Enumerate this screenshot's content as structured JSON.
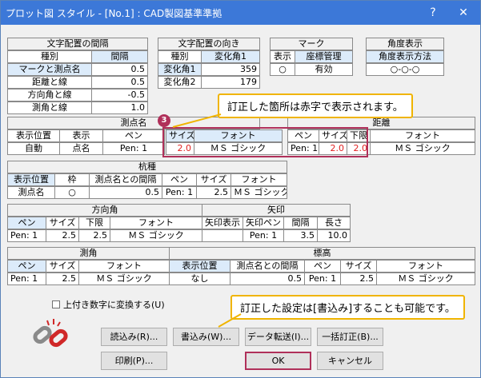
{
  "window": {
    "title": "プロット図 スタイル - [No.1] : CAD製図基準準拠",
    "help": "?",
    "close": "✕"
  },
  "moji_haichi": {
    "title": "文字配置の間隔",
    "col_kind": "種別",
    "col_interval": "間隔",
    "rows": [
      {
        "label": "マークと測点名",
        "value": "0.5"
      },
      {
        "label": "距離と線",
        "value": "0.5"
      },
      {
        "label": "方向角と線",
        "value": "-0.5"
      },
      {
        "label": "測角と線",
        "value": "1.0"
      }
    ]
  },
  "moji_muki": {
    "title": "文字配置の向き",
    "col_kind": "種別",
    "col_angle": "変化角1",
    "rows": [
      {
        "label": "変化角1",
        "value": "359"
      },
      {
        "label": "変化角2",
        "value": "179"
      }
    ]
  },
  "mark": {
    "title": "マーク",
    "col_display": "表示",
    "col_coord": "座標管理",
    "display": "○",
    "coord": "有効"
  },
  "angle_display": {
    "title": "角度表示",
    "col_method": "角度表示方法",
    "method": "○-○-○"
  },
  "sokuten": {
    "title": "測点名",
    "col_pos": "表示位置",
    "col_display": "表示",
    "col_pen": "ペン",
    "col_size": "サイズ",
    "col_font": "フォント",
    "pos": "自動",
    "display": "点名",
    "pen": "Pen: 1",
    "size": "2.0",
    "font": "ＭＳ ゴシック"
  },
  "kyori": {
    "title": "距離",
    "col_pen": "ペン",
    "col_size": "サイズ",
    "col_lower": "下限",
    "col_font": "フォント",
    "pen": "Pen: 1",
    "size": "2.0",
    "lower": "2.0",
    "font": "ＭＳ ゴシック"
  },
  "kuishu": {
    "title": "杭種",
    "col_pos": "表示位置",
    "col_frame": "枠",
    "col_gap": "測点名との間隔",
    "col_pen": "ペン",
    "col_size": "サイズ",
    "col_font": "フォント",
    "pos": "測点名",
    "frame": "○",
    "gap": "0.5",
    "pen": "Pen: 1",
    "size": "2.5",
    "font": "ＭＳ ゴシック"
  },
  "houkou": {
    "title": "方向角",
    "col_pen": "ペン",
    "col_size": "サイズ",
    "col_lower": "下限",
    "col_font": "フォント",
    "pen": "Pen: 1",
    "size": "2.5",
    "lower": "2.5",
    "font": "ＭＳ ゴシック"
  },
  "yajirushi": {
    "title": "矢印",
    "col_display": "矢印表示",
    "col_pen": "矢印ペン",
    "col_interval": "間隔",
    "col_length": "長さ",
    "display": "",
    "pen": "Pen: 1",
    "interval": "3.5",
    "length": "10.0"
  },
  "sokkaku": {
    "title": "測角",
    "col_pen": "ペン",
    "col_size": "サイズ",
    "col_font": "フォント",
    "pen": "Pen: 1",
    "size": "2.5",
    "font": "ＭＳ ゴシック"
  },
  "hyoukou": {
    "title": "標高",
    "col_pos": "表示位置",
    "col_gap": "測点名との間隔",
    "col_pen": "ペン",
    "col_size": "サイズ",
    "col_font": "フォント",
    "pos": "なし",
    "gap": "0.5",
    "pen": "Pen: 1",
    "size": "2.5",
    "font": "ＭＳ ゴシック"
  },
  "checkbox": {
    "label": "上付き数字に変換する(U)"
  },
  "buttons": {
    "read": "読込み(R)...",
    "write": "書込み(W)...",
    "transfer": "データ転送(I)...",
    "bulk": "一括訂正(B)...",
    "print": "印刷(P)...",
    "ok": "OK",
    "cancel": "キャンセル"
  },
  "callouts": {
    "badge": "3",
    "red_note": "訂正した箇所は赤字で表示されます。",
    "write_note": "訂正した設定は[書込み]することも可能です。"
  },
  "colors": {
    "titlebar": "#3c78d8",
    "highlight": "#b0305a",
    "callout_border": "#f0b400",
    "red_text": "#e02020"
  }
}
